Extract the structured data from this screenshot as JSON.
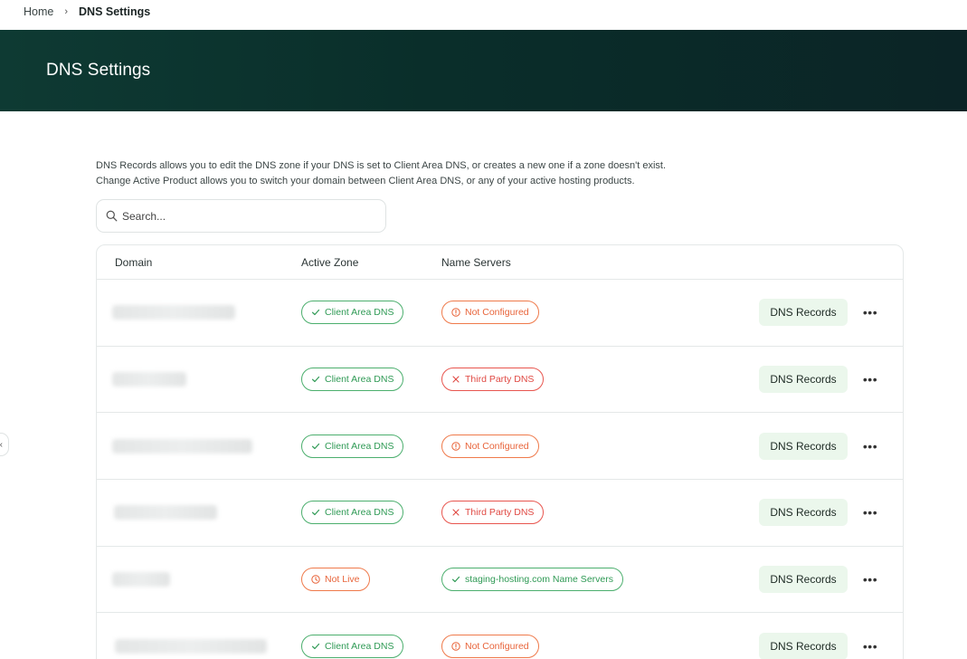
{
  "breadcrumb": {
    "home": "Home",
    "separator": "›",
    "current": "DNS Settings"
  },
  "header": {
    "title": "DNS Settings"
  },
  "sidebar_toggle": {
    "glyph": "‹"
  },
  "description": {
    "line1": "DNS Records allows you to edit the DNS zone if your DNS is set to Client Area DNS, or creates a new one if a zone doesn't exist.",
    "line2": "Change Active Product allows you to switch your domain between Client Area DNS, or any of your active hosting products."
  },
  "search": {
    "placeholder": "Search..."
  },
  "table": {
    "headers": {
      "domain": "Domain",
      "active_zone": "Active Zone",
      "name_servers": "Name Servers"
    },
    "action_label": "DNS Records",
    "more_glyph": "•••",
    "rows": [
      {
        "zone": "Client Area DNS",
        "zone_status": "ok",
        "ns": "Not Configured",
        "ns_status": "warning"
      },
      {
        "zone": "Client Area DNS",
        "zone_status": "ok",
        "ns": "Third Party DNS",
        "ns_status": "error"
      },
      {
        "zone": "Client Area DNS",
        "zone_status": "ok",
        "ns": "Not Configured",
        "ns_status": "warning"
      },
      {
        "zone": "Client Area DNS",
        "zone_status": "ok",
        "ns": "Third Party DNS",
        "ns_status": "error"
      },
      {
        "zone": "Not Live",
        "zone_status": "pending",
        "ns": "staging-hosting.com Name Servers",
        "ns_status": "ok"
      },
      {
        "zone": "Client Area DNS",
        "zone_status": "ok",
        "ns": "Not Configured",
        "ns_status": "warning"
      }
    ]
  },
  "colors": {
    "hero_bg": "#0b2e2b",
    "status_ok": "#2f9a55",
    "status_warning": "#e8643a",
    "status_error": "#e04943",
    "button_bg": "#ebf7ec"
  }
}
